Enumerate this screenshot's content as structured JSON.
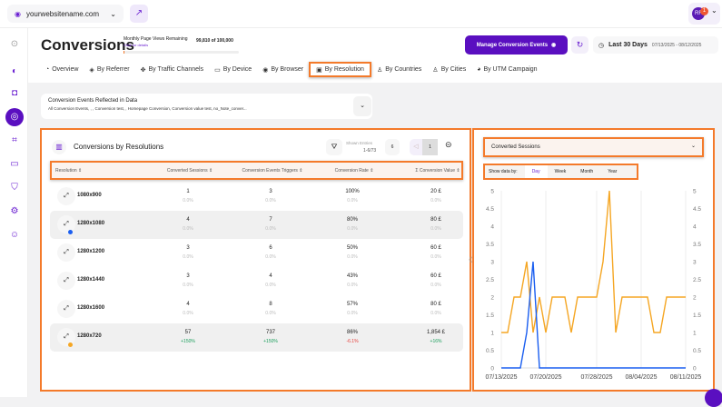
{
  "topbar": {
    "site": "yourwebsitename.com",
    "avatar_initials": "RF",
    "notifications": "1"
  },
  "header": {
    "title": "Conversions",
    "page_views_label": "Monthly Page Views Remaining",
    "page_views_link": "Click for details",
    "page_views_value": "99,810 of 100,000",
    "page_views_used_fraction": 0.0019,
    "manage_button": "Manage Conversion Events",
    "date_range_label": "Last 30 Days",
    "date_range": "07/13/2025 - 08/12/2025"
  },
  "tabs": [
    {
      "label": "Overview",
      "icon": "overview-icon"
    },
    {
      "label": "By Referrer",
      "icon": "referrer-icon"
    },
    {
      "label": "By Traffic Channels",
      "icon": "channels-icon"
    },
    {
      "label": "By Device",
      "icon": "device-icon"
    },
    {
      "label": "By Browser",
      "icon": "browser-icon"
    },
    {
      "label": "By Resolution",
      "icon": "resolution-icon",
      "active": true
    },
    {
      "label": "By Countries",
      "icon": "countries-icon"
    },
    {
      "label": "By Cities",
      "icon": "cities-icon"
    },
    {
      "label": "By UTM Campaign",
      "icon": "utm-icon"
    }
  ],
  "events": {
    "title": "Conversion Events Reflected in Data",
    "list": "All Conversion Events,            ,              , Conversion test,            , Homepage Conversion, Conversion value test, no_Note_conver..."
  },
  "table": {
    "title": "Conversions by Resolutions",
    "shown_label": "Shown Entries",
    "shown_value": "1-6/73",
    "page_size": "6",
    "page": "1",
    "columns": [
      "Resolution",
      "Converted Sessions",
      "Conversion Events Triggers",
      "Conversion Rate",
      "Σ Conversion Value"
    ],
    "rows": [
      {
        "name": "1080x900",
        "cells": [
          [
            "1",
            "0.0%"
          ],
          [
            "3",
            "0.0%"
          ],
          [
            "100%",
            "0.0%"
          ],
          [
            "20 £",
            "0.0%"
          ]
        ]
      },
      {
        "name": "1280x1080",
        "highlight": true,
        "dot": "#1a5ef0",
        "cells": [
          [
            "4",
            "0.0%"
          ],
          [
            "7",
            "0.0%"
          ],
          [
            "80%",
            "0.0%"
          ],
          [
            "80 £",
            "0.0%"
          ]
        ]
      },
      {
        "name": "1280x1200",
        "cells": [
          [
            "3",
            "0.0%"
          ],
          [
            "6",
            "0.0%"
          ],
          [
            "50%",
            "0.0%"
          ],
          [
            "60 £",
            "0.0%"
          ]
        ]
      },
      {
        "name": "1280x1440",
        "cells": [
          [
            "3",
            "0.0%"
          ],
          [
            "4",
            "0.0%"
          ],
          [
            "43%",
            "0.0%"
          ],
          [
            "60 £",
            "0.0%"
          ]
        ]
      },
      {
        "name": "1280x1600",
        "cells": [
          [
            "4",
            "0.0%"
          ],
          [
            "8",
            "0.0%"
          ],
          [
            "57%",
            "0.0%"
          ],
          [
            "80 £",
            "0.0%"
          ]
        ]
      },
      {
        "name": "1280x720",
        "highlight": true,
        "dot": "#f5a623",
        "cells": [
          [
            "57",
            "+150%"
          ],
          [
            "737",
            "+150%"
          ],
          [
            "86%",
            "-6.1%"
          ],
          [
            "1,854 £",
            "+16%"
          ]
        ]
      }
    ]
  },
  "chart": {
    "metric": "Converted Sessions",
    "show_by_label": "Show data by:",
    "periods": [
      "Day",
      "Week",
      "Month",
      "Year"
    ],
    "active_period": "Day"
  },
  "chart_data": {
    "type": "line",
    "ylim": [
      0,
      5
    ],
    "yticks": [
      "0",
      "0.5",
      "1",
      "1.5",
      "2",
      "2.5",
      "3",
      "3.5",
      "4",
      "4.5",
      "5"
    ],
    "xtick_labels": [
      "07/13/2025",
      "07/20/2025",
      "07/28/2025",
      "08/04/2025",
      "08/11/2025"
    ],
    "x": [
      "07/13",
      "07/14",
      "07/15",
      "07/16",
      "07/17",
      "07/18",
      "07/19",
      "07/20",
      "07/21",
      "07/22",
      "07/23",
      "07/24",
      "07/25",
      "07/26",
      "07/27",
      "07/28",
      "07/29",
      "07/30",
      "07/31",
      "08/01",
      "08/02",
      "08/03",
      "08/04",
      "08/05",
      "08/06",
      "08/07",
      "08/08",
      "08/09",
      "08/10",
      "08/11"
    ],
    "series": [
      {
        "color": "#f5a623",
        "values": [
          1,
          1,
          2,
          2,
          3,
          1,
          2,
          1,
          2,
          2,
          2,
          1,
          2,
          2,
          2,
          2,
          3,
          5,
          1,
          2,
          2,
          2,
          2,
          2,
          1,
          1,
          2,
          2,
          2,
          2
        ]
      },
      {
        "color": "#1a5ef0",
        "values": [
          0,
          0,
          0,
          0,
          1,
          3,
          0,
          0,
          0,
          0,
          0,
          0,
          0,
          0,
          0,
          0,
          0,
          0,
          0,
          0,
          0,
          0,
          0,
          0,
          0,
          0,
          0,
          0,
          0,
          0
        ]
      }
    ],
    "grid": "vertical at ticks"
  }
}
